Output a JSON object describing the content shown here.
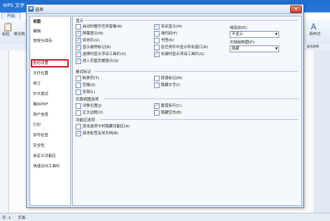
{
  "app": {
    "title": "WPS 文字",
    "tab": "开始",
    "paste": "粘贴",
    "format_painter": "格式刷",
    "new_style": "新样式",
    "find_replace": "查找替换",
    "status_left": "页: 1",
    "status_page": "页面"
  },
  "dialog": {
    "title": "选项",
    "close": "✕",
    "logo": "W"
  },
  "nav": [
    {
      "label": "视图",
      "selected": true
    },
    {
      "label": "编辑"
    },
    {
      "label": "常规与保存"
    },
    {
      "label": "各份设置"
    },
    {
      "label": "文件位置"
    },
    {
      "label": "修订"
    },
    {
      "label": "中文版式"
    },
    {
      "label": "输出PDF"
    },
    {
      "label": "用户信息"
    },
    {
      "label": "打印"
    },
    {
      "label": "拼写检查"
    },
    {
      "label": "安全性"
    },
    {
      "label": "自定义功能区"
    },
    {
      "label": "快速访问工具栏"
    }
  ],
  "content": {
    "display": {
      "title": "显示",
      "col1": [
        {
          "label": "启动时展开任务窗格(N)",
          "checked": false
        },
        {
          "label": "屏幕提示(N)",
          "checked": true
        },
        {
          "label": "状态栏(U)",
          "checked": true
        },
        {
          "label": "显示悬停标记(B)",
          "checked": true
        },
        {
          "label": "选择时显示浮动工具栏(D)",
          "checked": true
        },
        {
          "label": "进入页眉页脚提示(Q)",
          "checked": true
        }
      ],
      "col2": [
        {
          "label": "突出显示(H)",
          "checked": true
        },
        {
          "label": "域代码(F)",
          "checked": false
        },
        {
          "label": "书签(K)",
          "checked": false
        },
        {
          "label": "在任务栏中显示所有窗口(R)",
          "checked": false
        },
        {
          "label": "右键时显示浮动工具栏(G)",
          "checked": true
        }
      ],
      "field_shading_label": "域底纹(E):",
      "field_shading_value": "不显示",
      "nav_pane_label": "文档结构图(F):",
      "nav_pane_value": "隐藏"
    },
    "format_marks": {
      "title": "格式标记",
      "col1": [
        {
          "label": "制表符(T)",
          "checked": false
        },
        {
          "label": "空格(S)",
          "checked": false
        },
        {
          "label": "全部(L)",
          "checked": false
        }
      ],
      "col2": [
        {
          "label": "段落标记(M)",
          "checked": false
        },
        {
          "label": "隐藏文字(I)",
          "checked": false
        }
      ]
    },
    "page_view": {
      "title": "页面视图选项",
      "col1": [
        {
          "label": "对象位置(J)",
          "checked": false
        },
        {
          "label": "正文边框(X)",
          "checked": false
        }
      ],
      "col2": [
        {
          "label": "垂直标尺(C)",
          "checked": true
        },
        {
          "label": "隐藏空白(B)",
          "checked": false
        }
      ]
    },
    "features": {
      "title": "功能区选项",
      "items": [
        {
          "label": "双击选项卡时隐藏功能区(A)",
          "checked": false
        },
        {
          "label": "双击标签关闭文档(B)",
          "checked": true
        }
      ]
    }
  }
}
